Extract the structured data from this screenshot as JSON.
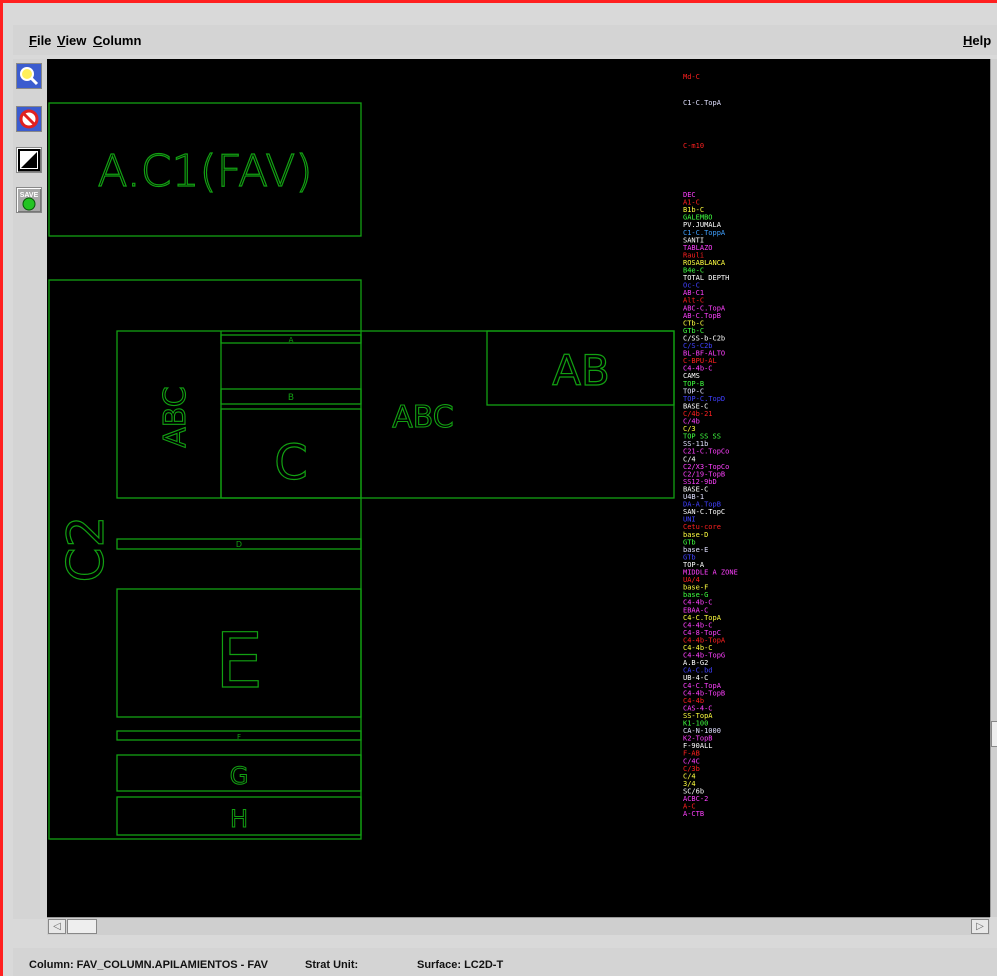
{
  "menu": {
    "file": {
      "first": "F",
      "rest": "ile"
    },
    "view": {
      "first": "V",
      "rest": "iew"
    },
    "column": {
      "first": "C",
      "rest": "olumn"
    },
    "help": {
      "first": "H",
      "rest": "elp"
    }
  },
  "toolbar": {
    "zoom_icon": "magnifier-icon",
    "no_icon": "prohibit-icon",
    "fit_icon": "fit-diagonal-icon",
    "save_label": "SAVE"
  },
  "canvas": {
    "line_color": "#12a012",
    "blocks": {
      "ac1": "A.C1(FAV)",
      "c2": "C2",
      "abc_vertical": "ABC",
      "abc": "ABC",
      "ab": "AB",
      "c": "C",
      "e": "E",
      "g": "G",
      "h": "H",
      "a_small": "A",
      "b_small": "B",
      "d_small": "D",
      "f_small": "F"
    },
    "surface_labels": [
      {
        "text": "Md-C",
        "color": "#ff2020"
      },
      {
        "text": "C1-C.TopA",
        "color": "#e0e0ff"
      },
      {
        "text": "C-m10",
        "color": "#ff2020"
      },
      {
        "text": "DEC",
        "color": "#ff40ff"
      },
      {
        "text": "A1-C",
        "color": "#ff2020"
      },
      {
        "text": "B1b-C",
        "color": "#ffff40"
      },
      {
        "text": "GALEMBO",
        "color": "#40ff40"
      },
      {
        "text": "PV.JUMALA",
        "color": "#ffffff"
      },
      {
        "text": "C1-C.ToppA",
        "color": "#40a0ff"
      },
      {
        "text": "SANTI",
        "color": "#ffffff"
      },
      {
        "text": "TABLAZO",
        "color": "#ff40ff"
      },
      {
        "text": "Rauli",
        "color": "#ff2020"
      },
      {
        "text": "ROSABLANCA",
        "color": "#ffff40"
      },
      {
        "text": "B4e-C",
        "color": "#40ff40"
      },
      {
        "text": "TOTAL DEPTH",
        "color": "#ffffff"
      },
      {
        "text": "Oc-C",
        "color": "#4040ff"
      },
      {
        "text": "AB-C1",
        "color": "#ff40ff"
      },
      {
        "text": "Alt-C",
        "color": "#ff2020"
      },
      {
        "text": "ABC-C.TopA",
        "color": "#ff40ff"
      },
      {
        "text": "AB-C.TopB",
        "color": "#ff40ff"
      },
      {
        "text": "CTb-C",
        "color": "#ffff40"
      },
      {
        "text": "GTb-C",
        "color": "#40ff40"
      },
      {
        "text": "C/SS-b-C2b",
        "color": "#ffffff"
      },
      {
        "text": "C/S-C2b",
        "color": "#4040ff"
      },
      {
        "text": "BL-BF-ALTO",
        "color": "#ff40ff"
      },
      {
        "text": "C-BPU-AL",
        "color": "#ff2020"
      },
      {
        "text": "C4-4b-C",
        "color": "#ff40ff"
      },
      {
        "text": "CAMS",
        "color": "#ffffff"
      },
      {
        "text": "TOP-B",
        "color": "#40ff40"
      },
      {
        "text": "TOP-C",
        "color": "#e0e0ff"
      },
      {
        "text": "TOP-C.TopD",
        "color": "#4040ff"
      },
      {
        "text": "BASE-C",
        "color": "#ffffff"
      },
      {
        "text": "C/4b-21",
        "color": "#ff2020"
      },
      {
        "text": "C/4b",
        "color": "#ff40ff"
      },
      {
        "text": "C/3",
        "color": "#ffff40"
      },
      {
        "text": "TOP SS SS",
        "color": "#40ff40"
      },
      {
        "text": "SS-11b",
        "color": "#e0e0ff"
      },
      {
        "text": "C21-C.TopCo",
        "color": "#ff40ff"
      },
      {
        "text": "C/4",
        "color": "#ffffff"
      },
      {
        "text": "C2/X3-TopCo",
        "color": "#ff40ff"
      },
      {
        "text": "C2/19-TopB",
        "color": "#ff40ff"
      },
      {
        "text": "SS12-9bD",
        "color": "#ff40ff"
      },
      {
        "text": "BASE-C",
        "color": "#ffffff"
      },
      {
        "text": "U4B-1",
        "color": "#e0e0ff"
      },
      {
        "text": "DA-A.TopB",
        "color": "#4040ff"
      },
      {
        "text": "SAN-C.TopC",
        "color": "#ffffff"
      },
      {
        "text": "UNI",
        "color": "#4040ff"
      },
      {
        "text": "Cetu-core",
        "color": "#ff2020"
      },
      {
        "text": "base-D",
        "color": "#ffff40"
      },
      {
        "text": "GTb",
        "color": "#40ff40"
      },
      {
        "text": "base-E",
        "color": "#e0e0ff"
      },
      {
        "text": "GTb",
        "color": "#4040ff"
      },
      {
        "text": "TOP-A",
        "color": "#ffffff"
      },
      {
        "text": "MIDDLE A ZONE",
        "color": "#ff40ff"
      },
      {
        "text": "UA/4",
        "color": "#ff2020"
      },
      {
        "text": "base-F",
        "color": "#ffff40"
      },
      {
        "text": "base-G",
        "color": "#40ff40"
      },
      {
        "text": "C4-4b-C",
        "color": "#ff40ff"
      },
      {
        "text": "EBAA-C",
        "color": "#ff40ff"
      },
      {
        "text": "C4-C.TopA",
        "color": "#ffff40"
      },
      {
        "text": "C4-4b-C",
        "color": "#ff40ff"
      },
      {
        "text": "C4-8-TopC",
        "color": "#ff40ff"
      },
      {
        "text": "C4-4b-TopA",
        "color": "#ff2020"
      },
      {
        "text": "C4-4b-C",
        "color": "#ffff40"
      },
      {
        "text": "C4-4b-TopG",
        "color": "#ff40ff"
      },
      {
        "text": "A.B-G2",
        "color": "#ffffff"
      },
      {
        "text": "CA-C.bd",
        "color": "#4040ff"
      },
      {
        "text": "UB-4-C",
        "color": "#ffffff"
      },
      {
        "text": "C4-C.TopA",
        "color": "#ff40ff"
      },
      {
        "text": "C4-4b-TopB",
        "color": "#ff40ff"
      },
      {
        "text": "C4-4b",
        "color": "#ff2020"
      },
      {
        "text": "CAS-4-C",
        "color": "#ff40ff"
      },
      {
        "text": "SS-TopA",
        "color": "#ffff40"
      },
      {
        "text": "K1-100",
        "color": "#40ff40"
      },
      {
        "text": "CA-N-1000",
        "color": "#e0e0ff"
      },
      {
        "text": "K2-TopB",
        "color": "#ff40ff"
      },
      {
        "text": "F-90ALL",
        "color": "#ffffff"
      },
      {
        "text": "F-AB",
        "color": "#ff2020"
      },
      {
        "text": "C/4C",
        "color": "#ff40ff"
      },
      {
        "text": "C/3b",
        "color": "#ff2020"
      },
      {
        "text": "C/4",
        "color": "#ffff40"
      },
      {
        "text": "3/4",
        "color": "#ffff40"
      },
      {
        "text": "SC/6b",
        "color": "#ffffff"
      },
      {
        "text": "ACBC-2",
        "color": "#ff40ff"
      },
      {
        "text": "A-C",
        "color": "#ff2020"
      },
      {
        "text": "A-CTB",
        "color": "#ff40ff"
      }
    ]
  },
  "status": {
    "column": "Column: FAV_COLUMN.APILAMIENTOS - FAV",
    "strat_unit": "Strat Unit:",
    "surface": "Surface: LC2D-T"
  }
}
